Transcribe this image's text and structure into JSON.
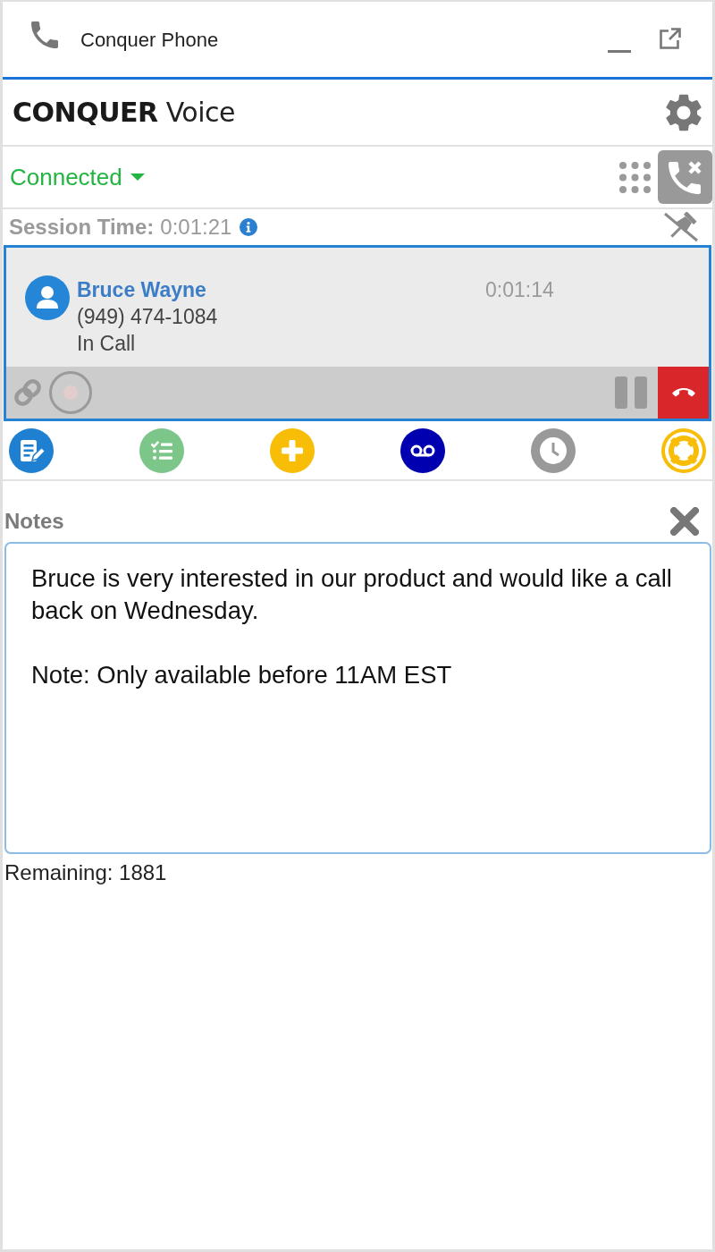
{
  "window": {
    "title": "Conquer Phone"
  },
  "brand": {
    "logo": "**CONQUER** Voice"
  },
  "status": {
    "label": "Connected"
  },
  "session": {
    "label": "Session Time:",
    "value": "0:01:21"
  },
  "call": {
    "selected": true,
    "name": "Bruce Wayne",
    "duration": "0:01:14",
    "number": "(949) 474-1084",
    "state": "In Call",
    "recording": false
  },
  "actions": [
    {
      "kind": "notes",
      "color": "#1f80d2"
    },
    {
      "kind": "tasks",
      "color": "#7cc68a"
    },
    {
      "kind": "add",
      "color": "#f8bd07"
    },
    {
      "kind": "voicemail",
      "color": "#0000b0"
    },
    {
      "kind": "history",
      "color": "#999999"
    },
    {
      "kind": "help",
      "color": "#f8bd07"
    }
  ],
  "notes": {
    "title": "Notes",
    "text": "Bruce is very interested in our product and would like a call back on Wednesday.\n\nNote: Only available before 11AM EST",
    "remaining": "Remaining: 1881"
  }
}
